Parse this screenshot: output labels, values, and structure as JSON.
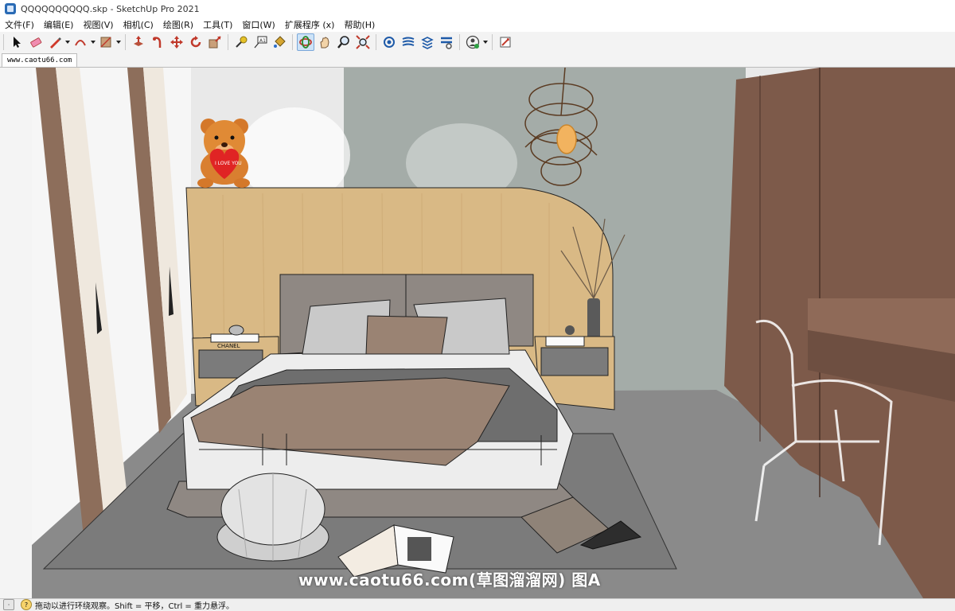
{
  "window": {
    "title": "QQQQQQQQQQ.skp - SketchUp Pro 2021"
  },
  "menu": [
    "文件(F)",
    "编辑(E)",
    "视图(V)",
    "相机(C)",
    "绘图(R)",
    "工具(T)",
    "窗口(W)",
    "扩展程序 (x)",
    "帮助(H)"
  ],
  "toolbar": {
    "tools": [
      {
        "name": "select-icon"
      },
      {
        "name": "eraser-icon"
      },
      {
        "name": "pencil-line-icon",
        "dropdown": true
      },
      {
        "name": "arc-icon",
        "dropdown": true
      },
      {
        "name": "rectangle-icon",
        "dropdown": true
      },
      {
        "name": "push-pull-icon"
      },
      {
        "name": "follow-me-icon"
      },
      {
        "name": "move-icon"
      },
      {
        "name": "rotate-icon"
      },
      {
        "name": "scale-icon"
      },
      {
        "name": "tape-measure-icon"
      },
      {
        "name": "text-icon"
      },
      {
        "name": "paint-bucket-icon"
      },
      {
        "name": "orbit-icon",
        "active": true
      },
      {
        "name": "pan-icon"
      },
      {
        "name": "zoom-icon"
      },
      {
        "name": "zoom-extents-icon"
      },
      {
        "name": "3d-warehouse-icon"
      },
      {
        "name": "extension-warehouse-icon"
      },
      {
        "name": "layout-icon"
      },
      {
        "name": "extension-manager-icon"
      },
      {
        "name": "account-icon",
        "dropdown": true
      },
      {
        "name": "add-location-icon"
      }
    ]
  },
  "scene_tab": "www.caotu66.com",
  "viewport": {
    "watermark": "www.caotu66.com(草图溜溜网) 图A",
    "pillow_text": "I LOVE YOU",
    "book_text": "CHANEL",
    "colors": {
      "wall": "#e9e9e9",
      "concrete_wall": "#9aa39f",
      "headboard_wood": "#d9b985",
      "floor": "#8c8c8c",
      "rug": "#7b7b7b",
      "wardrobe": "#7d5a4a",
      "curtain": "#8d6e5b",
      "bed_frame": "#8f8883"
    }
  },
  "status": {
    "text": "拖动以进行环绕观察。Shift = 平移，Ctrl = 重力悬浮。"
  }
}
